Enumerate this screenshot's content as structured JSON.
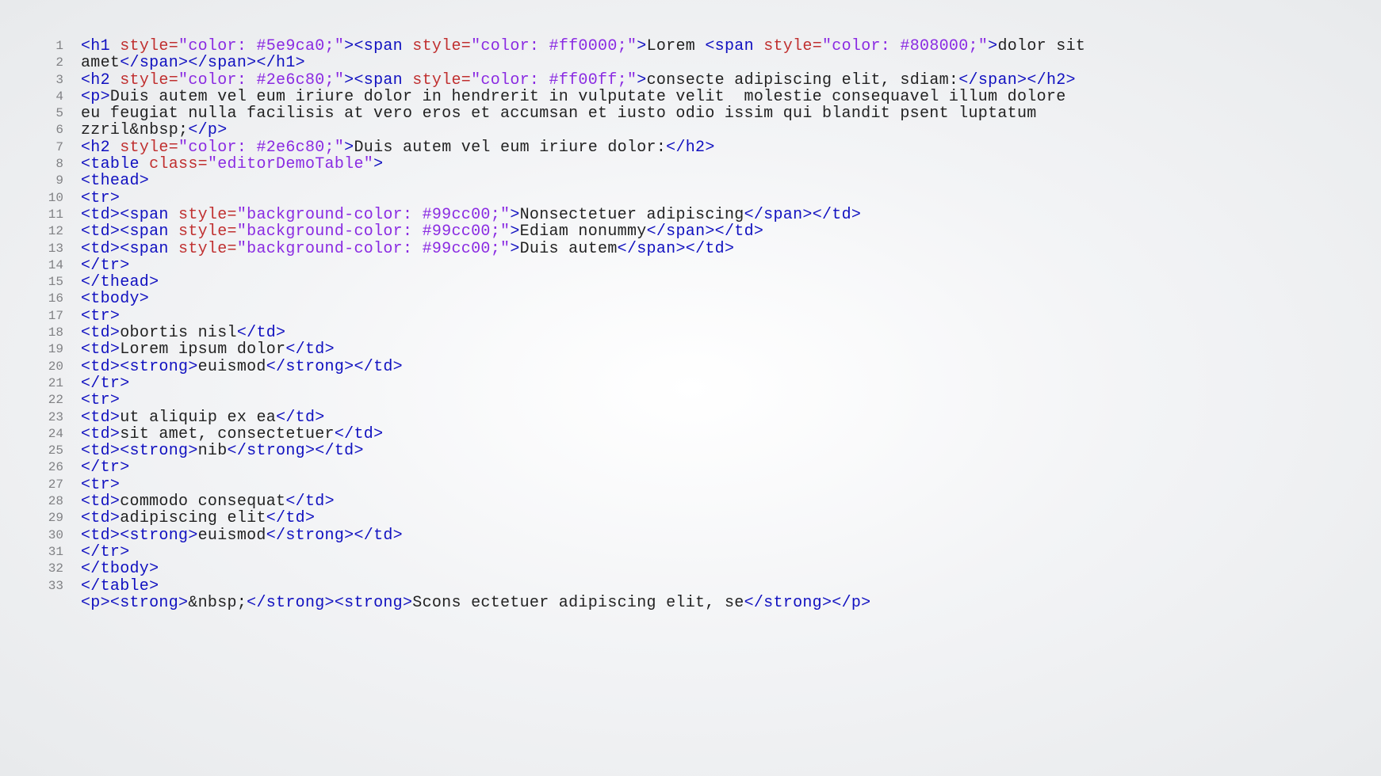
{
  "lineNumbers": [
    "1",
    "2",
    "3",
    "4",
    "5",
    "6",
    "7",
    "8",
    "9",
    "10",
    "11",
    "12",
    "13",
    "14",
    "15",
    "16",
    "17",
    "18",
    "19",
    "20",
    "21",
    "22",
    "23",
    "24",
    "25",
    "26",
    "27",
    "28",
    "29",
    "30",
    "31",
    "32",
    "33"
  ],
  "code": {
    "rows": [
      [
        {
          "c": "t",
          "s": "<h1 "
        },
        {
          "c": "a",
          "s": "style="
        },
        {
          "c": "v",
          "s": "\"color: #5e9ca0;\""
        },
        {
          "c": "t",
          "s": "><span "
        },
        {
          "c": "a",
          "s": "style="
        },
        {
          "c": "v",
          "s": "\"color: #ff0000;\""
        },
        {
          "c": "t",
          "s": ">"
        },
        {
          "c": "tx",
          "s": "Lorem "
        },
        {
          "c": "t",
          "s": "<span "
        },
        {
          "c": "a",
          "s": "style="
        },
        {
          "c": "v",
          "s": "\"color: #808000;\""
        },
        {
          "c": "t",
          "s": ">"
        },
        {
          "c": "tx",
          "s": "dolor sit"
        }
      ],
      [
        {
          "c": "tx",
          "s": "amet"
        },
        {
          "c": "t",
          "s": "</span></span></h1>"
        }
      ],
      [
        {
          "c": "t",
          "s": "<h2 "
        },
        {
          "c": "a",
          "s": "style="
        },
        {
          "c": "v",
          "s": "\"color: #2e6c80;\""
        },
        {
          "c": "t",
          "s": "><span "
        },
        {
          "c": "a",
          "s": "style="
        },
        {
          "c": "v",
          "s": "\"color: #ff00ff;\""
        },
        {
          "c": "t",
          "s": ">"
        },
        {
          "c": "tx",
          "s": "consecte adipiscing elit, sdiam:"
        },
        {
          "c": "t",
          "s": "</span></h2>"
        }
      ],
      [
        {
          "c": "t",
          "s": "<p>"
        },
        {
          "c": "tx",
          "s": "Duis autem vel eum iriure dolor in hendrerit in vulputate velit  molestie consequavel illum dolore"
        }
      ],
      [
        {
          "c": "tx",
          "s": "eu feugiat nulla facilisis at vero eros et accumsan et iusto odio issim qui blandit psent luptatum"
        }
      ],
      [
        {
          "c": "tx",
          "s": "zzril&nbsp;"
        },
        {
          "c": "t",
          "s": "</p>"
        }
      ],
      [
        {
          "c": "t",
          "s": "<h2 "
        },
        {
          "c": "a",
          "s": "style="
        },
        {
          "c": "v",
          "s": "\"color: #2e6c80;\""
        },
        {
          "c": "t",
          "s": ">"
        },
        {
          "c": "tx",
          "s": "Duis autem vel eum iriure dolor:"
        },
        {
          "c": "t",
          "s": "</h2>"
        }
      ],
      [
        {
          "c": "t",
          "s": "<table "
        },
        {
          "c": "a",
          "s": "class="
        },
        {
          "c": "v",
          "s": "\"editorDemoTable\""
        },
        {
          "c": "t",
          "s": ">"
        }
      ],
      [
        {
          "c": "t",
          "s": "<thead>"
        }
      ],
      [
        {
          "c": "t",
          "s": "<tr>"
        }
      ],
      [
        {
          "c": "t",
          "s": "<td><span "
        },
        {
          "c": "a",
          "s": "style="
        },
        {
          "c": "v",
          "s": "\"background-color: #99cc00;\""
        },
        {
          "c": "t",
          "s": ">"
        },
        {
          "c": "tx",
          "s": "Nonsectetuer adipiscing"
        },
        {
          "c": "t",
          "s": "</span></td>"
        }
      ],
      [
        {
          "c": "t",
          "s": "<td><span "
        },
        {
          "c": "a",
          "s": "style="
        },
        {
          "c": "v",
          "s": "\"background-color: #99cc00;\""
        },
        {
          "c": "t",
          "s": ">"
        },
        {
          "c": "tx",
          "s": "Ediam nonummy"
        },
        {
          "c": "t",
          "s": "</span></td>"
        }
      ],
      [
        {
          "c": "t",
          "s": "<td><span "
        },
        {
          "c": "a",
          "s": "style="
        },
        {
          "c": "v",
          "s": "\"background-color: #99cc00;\""
        },
        {
          "c": "t",
          "s": ">"
        },
        {
          "c": "tx",
          "s": "Duis autem"
        },
        {
          "c": "t",
          "s": "</span></td>"
        }
      ],
      [
        {
          "c": "t",
          "s": "</tr>"
        }
      ],
      [
        {
          "c": "t",
          "s": "</thead>"
        }
      ],
      [
        {
          "c": "t",
          "s": "<tbody>"
        }
      ],
      [
        {
          "c": "t",
          "s": "<tr>"
        }
      ],
      [
        {
          "c": "t",
          "s": "<td>"
        },
        {
          "c": "tx",
          "s": "obortis nisl"
        },
        {
          "c": "t",
          "s": "</td>"
        }
      ],
      [
        {
          "c": "t",
          "s": "<td>"
        },
        {
          "c": "tx",
          "s": "Lorem ipsum dolor"
        },
        {
          "c": "t",
          "s": "</td>"
        }
      ],
      [
        {
          "c": "t",
          "s": "<td><strong>"
        },
        {
          "c": "tx",
          "s": "euismod"
        },
        {
          "c": "t",
          "s": "</strong></td>"
        }
      ],
      [
        {
          "c": "t",
          "s": "</tr>"
        }
      ],
      [
        {
          "c": "t",
          "s": "<tr>"
        }
      ],
      [
        {
          "c": "t",
          "s": "<td>"
        },
        {
          "c": "tx",
          "s": "ut aliquip ex ea"
        },
        {
          "c": "t",
          "s": "</td>"
        }
      ],
      [
        {
          "c": "t",
          "s": "<td>"
        },
        {
          "c": "tx",
          "s": "sit amet, consectetuer"
        },
        {
          "c": "t",
          "s": "</td>"
        }
      ],
      [
        {
          "c": "t",
          "s": "<td><strong>"
        },
        {
          "c": "tx",
          "s": "nib"
        },
        {
          "c": "t",
          "s": "</strong></td>"
        }
      ],
      [
        {
          "c": "t",
          "s": "</tr>"
        }
      ],
      [
        {
          "c": "t",
          "s": "<tr>"
        }
      ],
      [
        {
          "c": "t",
          "s": "<td>"
        },
        {
          "c": "tx",
          "s": "commodo consequat"
        },
        {
          "c": "t",
          "s": "</td>"
        }
      ],
      [
        {
          "c": "t",
          "s": "<td>"
        },
        {
          "c": "tx",
          "s": "adipiscing elit"
        },
        {
          "c": "t",
          "s": "</td>"
        }
      ],
      [
        {
          "c": "t",
          "s": "<td><strong>"
        },
        {
          "c": "tx",
          "s": "euismod"
        },
        {
          "c": "t",
          "s": "</strong></td>"
        }
      ],
      [
        {
          "c": "t",
          "s": "</tr>"
        }
      ],
      [
        {
          "c": "t",
          "s": "</tbody>"
        }
      ],
      [
        {
          "c": "t",
          "s": "</table>"
        }
      ],
      [
        {
          "c": "t",
          "s": "<p><strong>"
        },
        {
          "c": "tx",
          "s": "&nbsp;"
        },
        {
          "c": "t",
          "s": "</strong><strong>"
        },
        {
          "c": "tx",
          "s": "Scons ectetuer adipiscing elit, se"
        },
        {
          "c": "t",
          "s": "</strong></p>"
        }
      ]
    ]
  }
}
